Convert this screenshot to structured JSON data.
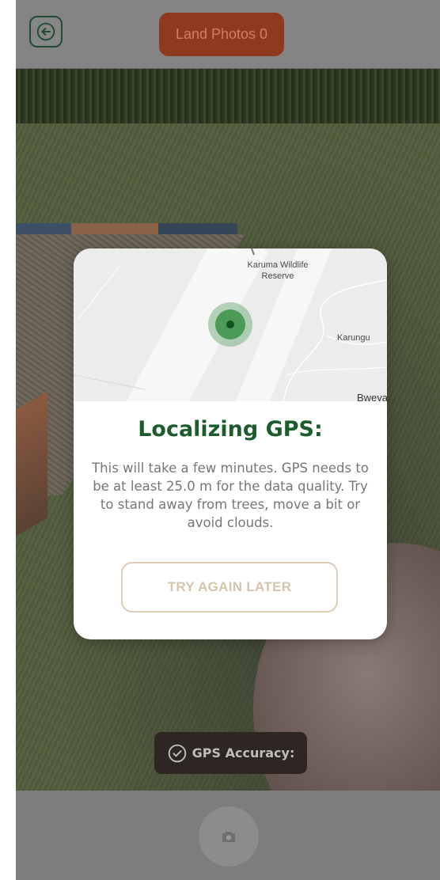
{
  "header": {
    "back_icon": "arrow-left-icon",
    "land_photos_label": "Land Photos 0"
  },
  "map": {
    "labels": {
      "reserve": "Karuma Wildlife\nReserve",
      "town1": "Karungu",
      "town2": "Bweya"
    },
    "location_icon": "gps-location-dot-icon"
  },
  "dialog": {
    "title": "Localizing GPS:",
    "message": "This will take a few minutes. GPS needs to be at least 25.0 m for the data quality. Try to stand away from trees, move a bit or avoid clouds.",
    "button_label": "TRY AGAIN LATER"
  },
  "status": {
    "gps_accuracy_label": "GPS Accuracy:",
    "check_icon": "check-circle-icon"
  },
  "camera": {
    "shutter_icon": "camera-icon"
  },
  "colors": {
    "accent_green": "#1d5c2c",
    "land_photos_bg": "#8f3a1f",
    "button_border": "#ddcdb7"
  }
}
